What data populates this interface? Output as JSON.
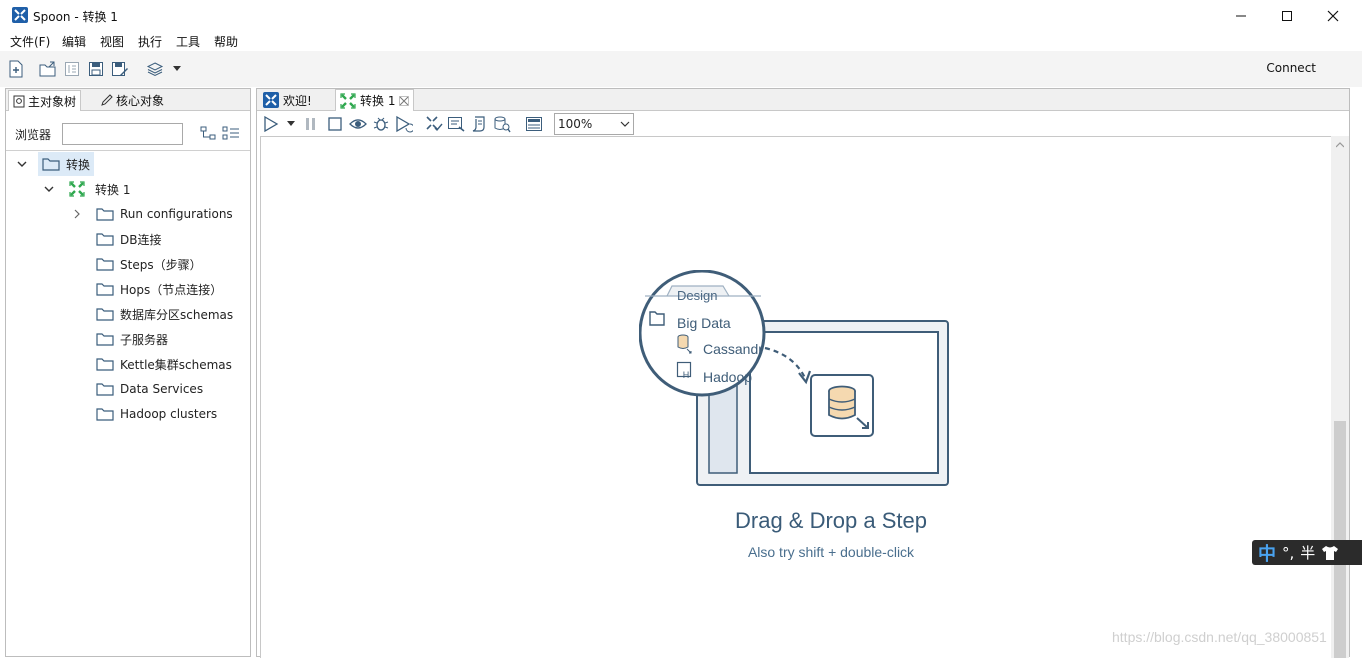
{
  "window": {
    "title": "Spoon - 转换 1"
  },
  "menu": [
    "文件(F)",
    "编辑",
    "视图",
    "执行",
    "工具",
    "帮助"
  ],
  "toolbar": {
    "connect_label": "Connect"
  },
  "left_tabs": {
    "main_tree": "主对象树",
    "core_objects": "核心对象"
  },
  "browser": {
    "label": "浏览器",
    "value": ""
  },
  "tree": {
    "root": "转换",
    "trans": "转换 1",
    "children": [
      "Run configurations",
      "DB连接",
      "Steps（步骤）",
      "Hops（节点连接）",
      "数据库分区schemas",
      "子服务器",
      "Kettle集群schemas",
      "Data Services",
      "Hadoop clusters"
    ]
  },
  "right_tabs": {
    "welcome": "欢迎!",
    "trans": "转换 1"
  },
  "zoom": {
    "value": "100%"
  },
  "canvas": {
    "illustration": {
      "tab": "Design",
      "folder": "Big Data",
      "item1": "Cassandr",
      "item2": "Hadoop",
      "item2_badge": "H"
    },
    "title": "Drag & Drop a Step",
    "subtitle": "Also try shift + double-click"
  },
  "ime": {
    "mode": "中",
    "punct": "°,",
    "width": "半"
  },
  "watermark": "https://blog.csdn.net/qq_38000851",
  "colors": {
    "accent": "#3a5b78",
    "selection": "#dceaf7",
    "tree_green": "#2fa84f"
  }
}
